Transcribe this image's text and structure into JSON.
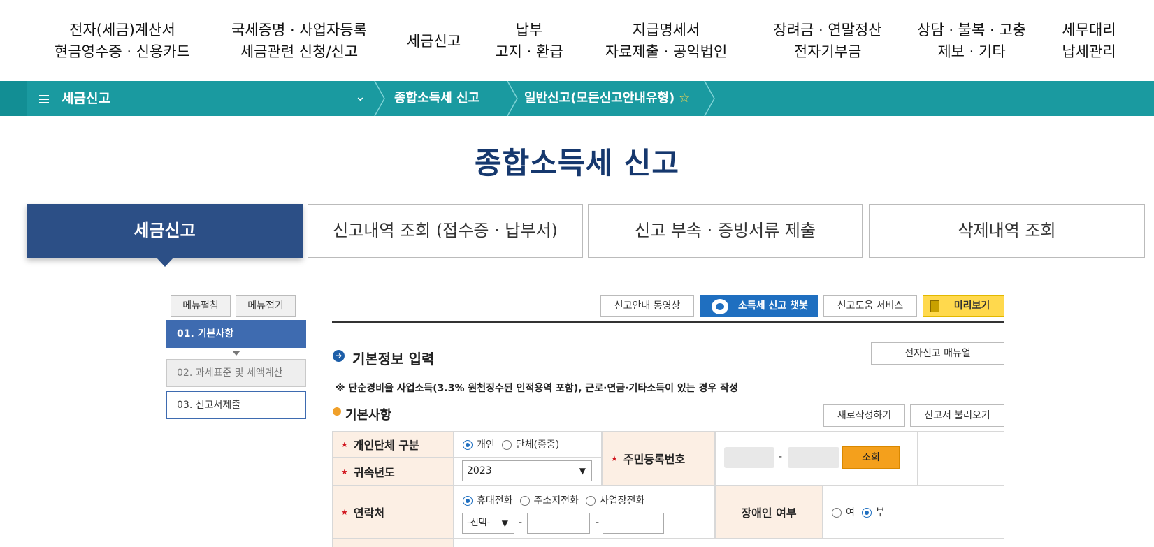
{
  "top_nav": [
    {
      "line1": "전자(세금)계산서",
      "line2": "현금영수증 · 신용카드"
    },
    {
      "line1": "국세증명 · 사업자등록",
      "line2": "세금관련 신청/신고"
    },
    {
      "line1": "세금신고",
      "line2": ""
    },
    {
      "line1": "납부",
      "line2": "고지 · 환급"
    },
    {
      "line1": "지급명세서",
      "line2": "자료제출 · 공익법인"
    },
    {
      "line1": "장려금 · 연말정산",
      "line2": "전자기부금"
    },
    {
      "line1": "상담 · 불복 · 고충",
      "line2": "제보 · 기타"
    },
    {
      "line1": "세무대리",
      "line2": "납세관리"
    }
  ],
  "breadcrumb_bar": {
    "menu_label": "세금신고",
    "crumb1": "종합소득세 신고",
    "crumb2": "일반신고(모든신고안내유형)",
    "star": "☆"
  },
  "page_title": "종합소득세 신고",
  "tabs": [
    {
      "label": "세금신고",
      "active": true
    },
    {
      "label": "신고내역 조회 (접수증 · 납부서)",
      "active": false
    },
    {
      "label": "신고 부속 · 증빙서류 제출",
      "active": false
    },
    {
      "label": "삭제내역 조회",
      "active": false
    }
  ],
  "side_menu": {
    "expand_label": "메뉴펼침",
    "collapse_label": "메뉴접기",
    "steps": [
      {
        "label": "01. 기본사항",
        "state": "active"
      },
      {
        "label": "02. 과세표준 및 세액계산",
        "state": "disabled"
      },
      {
        "label": "03. 신고서제출",
        "state": "normal"
      }
    ]
  },
  "toolbar": {
    "video_guide": "신고안내 동영상",
    "chatbot": "소득세 신고 챗봇",
    "help_service": "신고도움 서비스",
    "preview": "미리보기"
  },
  "section": {
    "title": "기본정보 입력",
    "manual_button": "전자신고 매뉴얼",
    "note": "※ 단순경비율 사업소득(3.3% 원천징수된 인적용역 포함), 근로·연금·기타소득이 있는 경우 작성",
    "subtitle": "기본사항",
    "new_button": "새로작성하기",
    "load_button": "신고서 불러오기"
  },
  "form": {
    "type_label": "개인단체 구분",
    "type_options": [
      "개인",
      "단체(종중)"
    ],
    "type_selected": "개인",
    "year_label": "귀속년도",
    "year_value": "2023",
    "rrn_label": "주민등록번호",
    "rrn_sep": "-",
    "query_button": "조회",
    "contact_label": "연락처",
    "contact_options": [
      "휴대전화",
      "주소지전화",
      "사업장전화"
    ],
    "contact_selected": "휴대전화",
    "phone_prefix": "-선택-",
    "phone_sep": "-",
    "disabled_label": "장애인 여부",
    "disabled_options": [
      "여",
      "부"
    ],
    "disabled_selected": "부"
  },
  "colors": {
    "teal_bar": "#1a9aa0",
    "navy_title": "#16386e",
    "active_tab": "#2c4f86",
    "active_step": "#3e6bb0",
    "chatbot_blue": "#1f6fc0",
    "preview_yellow": "#ffd94d",
    "label_bg": "#fcefe4",
    "query_orange": "#f4a01c"
  }
}
